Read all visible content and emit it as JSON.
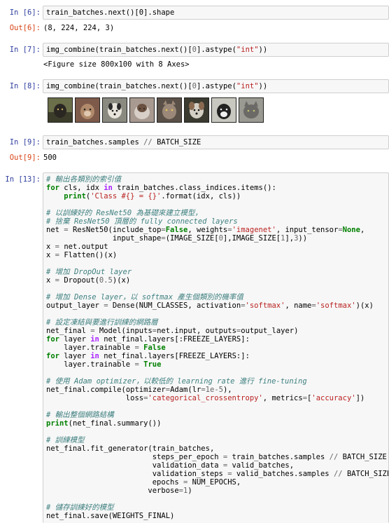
{
  "cells": [
    {
      "prompt": "In [6]:",
      "code": "train_batches.next()[0].shape",
      "out_prompt": "Out[6]:",
      "output": "(8, 224, 224, 3)"
    },
    {
      "prompt": "In [7]:",
      "code": "img_combine(train_batches.next()[0].astype(\"int\"))",
      "output": "<Figure size 800x100 with 8 Axes>"
    },
    {
      "prompt": "In [8]:",
      "code": "img_combine(train_batches.next()[0].astype(\"int\"))",
      "output_images": [
        "cat",
        "dog",
        "dog",
        "cat",
        "cat",
        "dog",
        "dog",
        "cat"
      ]
    },
    {
      "prompt": "In [9]:",
      "code": "train_batches.samples // BATCH_SIZE",
      "out_prompt": "Out[9]:",
      "output": "500"
    },
    {
      "prompt": "In [13]:",
      "code_lines": [
        "# 輸出各類別的索引值",
        "for cls, idx in train_batches.class_indices.items():",
        "    print('Class #{} = {}'.format(idx, cls))",
        "",
        "# 以訓練好的 ResNet50 為基礎來建立模型，",
        "# 捨棄 ResNet50 頂層的 fully connected layers",
        "net = ResNet50(include_top=False, weights='imagenet', input_tensor=None,",
        "               input_shape=(IMAGE_SIZE[0],IMAGE_SIZE[1],3))",
        "x = net.output",
        "x = Flatten()(x)",
        "",
        "# 增加 DropOut layer",
        "x = Dropout(0.5)(x)",
        "",
        "# 增加 Dense layer，以 softmax 產生個類別的機率值",
        "output_layer = Dense(NUM_CLASSES, activation='softmax', name='softmax')(x)",
        "",
        "# 設定凍結與要進行訓練的網路層",
        "net_final = Model(inputs=net.input, outputs=output_layer)",
        "for layer in net_final.layers[:FREEZE_LAYERS]:",
        "    layer.trainable = False",
        "for layer in net_final.layers[FREEZE_LAYERS:]:",
        "    layer.trainable = True",
        "",
        "# 使用 Adam optimizer，以較低的 learning rate 進行 fine-tuning",
        "net_final.compile(optimizer=Adam(lr=1e-5),",
        "                  loss='categorical_crossentropy', metrics=['accuracy'])",
        "",
        "# 輸出整個網路結構",
        "print(net_final.summary())",
        "",
        "# 訓練模型",
        "net_final.fit_generator(train_batches,",
        "                        steps_per_epoch = train_batches.samples // BATCH_SIZE,",
        "                        validation_data = valid_batches,",
        "                        validation_steps = valid_batches.samples // BATCH_SIZE,",
        "                        epochs = NUM_EPOCHS,",
        "                       verbose=1)",
        "",
        "# 儲存訓練好的模型",
        "net_final.save(WEIGHTS_FINAL)"
      ]
    }
  ],
  "colors": {
    "in_prompt": "#303f9f",
    "out_prompt": "#d84315",
    "comment": "#408080",
    "keyword": "#008000",
    "string": "#ba2121"
  }
}
